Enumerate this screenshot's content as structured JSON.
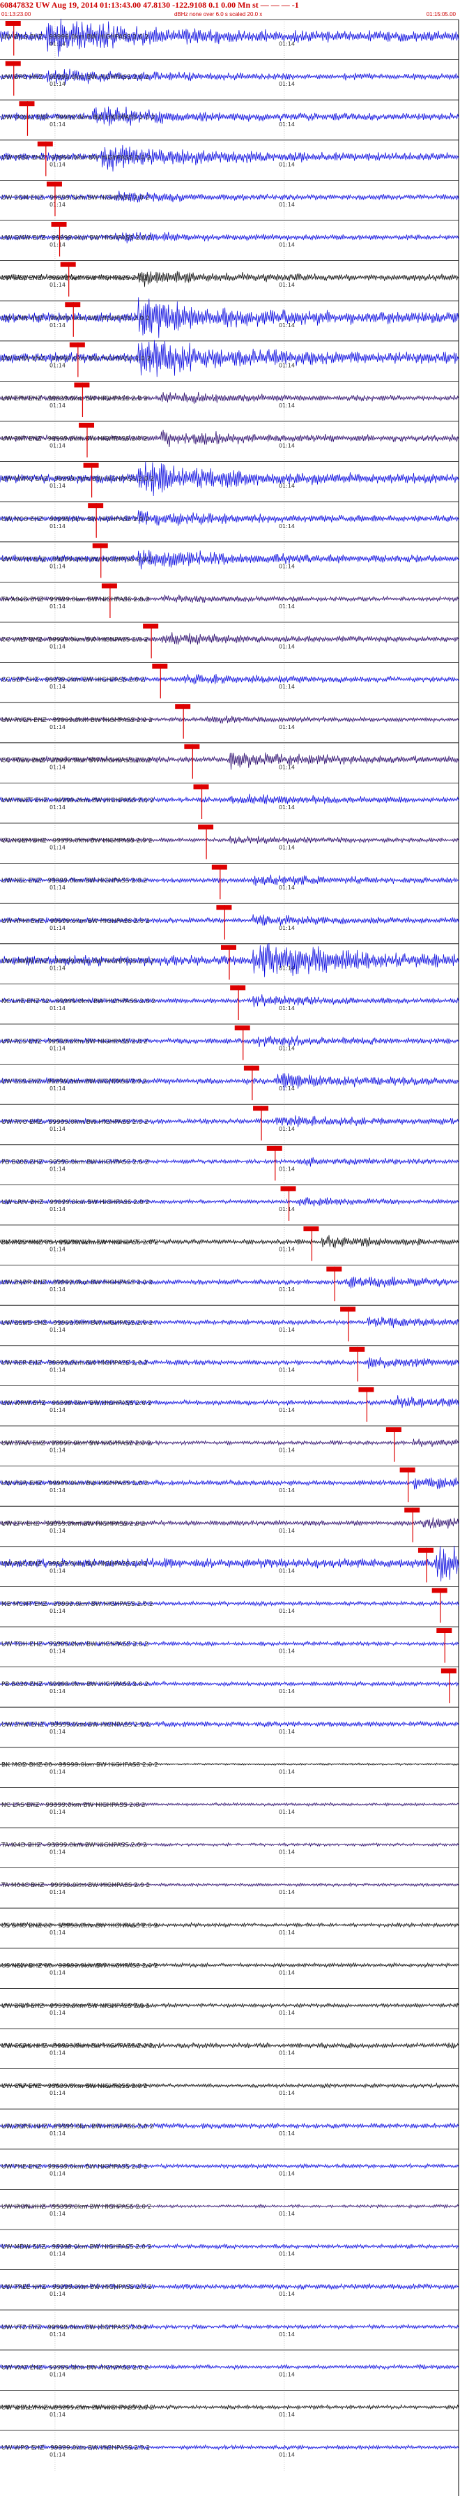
{
  "header": {
    "title": "60847832 UW Aug 19, 2014 01:13:43.00   47.8130  -122.9108  0.1 0.00 Mn st — — — -1",
    "left_time": "01:13:23.00",
    "right_time": "01:15:05.00",
    "scale_note": "dBHz none over 6.0 s scaled 20.0 x"
  },
  "colors": {
    "trace_blue": "#0000dd",
    "trace_dark": "#220066",
    "trace_black": "#000000",
    "pick_red": "#dd0000",
    "frame": "#000000"
  },
  "chart_data": {
    "type": "line",
    "tick_label": "01:14",
    "filter_suffix": "- 99999.0km BW HIGHPASS 2.0 2",
    "traces": [
      {
        "station": "UW BILS EHZ",
        "amp": 1.0,
        "color": "blue",
        "pick": 0.03,
        "burst": 0.1
      },
      {
        "station": "UW BPO HHZ",
        "amp": 0.6,
        "color": "blue",
        "pick": 0.03,
        "burst": 0.1
      },
      {
        "station": "UW OOW2 ENZ",
        "amp": 0.7,
        "color": "blue",
        "pick": 0.06,
        "burst": 0.2
      },
      {
        "station": "UW FRSP EHZ",
        "amp": 0.8,
        "color": "blue",
        "pick": 0.1,
        "burst": 0.22
      },
      {
        "station": "UW SQM EHZ",
        "amp": 0.5,
        "color": "blue",
        "pick": 0.12,
        "burst": 0.25
      },
      {
        "station": "UW GMW EHZ",
        "amp": 0.5,
        "color": "blue",
        "pick": 0.13,
        "burst": 0.25
      },
      {
        "station": "UW OBL EHZ",
        "amp": 0.6,
        "color": "black",
        "pick": 0.15,
        "burst": 0.3
      },
      {
        "station": "UW KMR HHZ",
        "amp": 1.0,
        "color": "blue",
        "pick": 0.16,
        "burst": 0.3
      },
      {
        "station": "UW GHW EHZ",
        "amp": 1.0,
        "color": "blue",
        "pick": 0.17,
        "burst": 0.3
      },
      {
        "station": "UW EPH EHZ",
        "amp": 0.5,
        "color": "dark",
        "pick": 0.18,
        "burst": 0.35
      },
      {
        "station": "UW PNT EHZ",
        "amp": 0.6,
        "color": "dark",
        "pick": 0.19,
        "burst": 0.35
      },
      {
        "station": "UW MVRO EHZ",
        "amp": 0.9,
        "color": "blue",
        "pick": 0.2,
        "burst": 0.3
      },
      {
        "station": "UW NCO EHZ",
        "amp": 0.6,
        "color": "blue",
        "pick": 0.21,
        "burst": 0.3
      },
      {
        "station": "UW OPYH EHZ",
        "amp": 0.7,
        "color": "blue",
        "pick": 0.22,
        "burst": 0.3
      },
      {
        "station": "TA A04D BHZ",
        "amp": 0.4,
        "color": "dark",
        "pick": 0.24,
        "burst": 0.35
      },
      {
        "station": "CC VALT BHZ",
        "amp": 0.5,
        "color": "dark",
        "pick": 0.33,
        "burst": 0.35
      },
      {
        "station": "CC SEP EHZ",
        "amp": 0.5,
        "color": "blue",
        "pick": 0.35,
        "burst": 0.4
      },
      {
        "station": "UW RVCH EHZ",
        "amp": 0.4,
        "color": "dark",
        "pick": 0.4,
        "burst": 0.45
      },
      {
        "station": "CC TGBU BHZ",
        "amp": 0.6,
        "color": "dark",
        "pick": 0.42,
        "burst": 0.5
      },
      {
        "station": "UW HWET EHZ",
        "amp": 0.5,
        "color": "blue",
        "pick": 0.44,
        "burst": 0.5
      },
      {
        "station": "CC NGEM BHZ",
        "amp": 0.4,
        "color": "dark",
        "pick": 0.45,
        "burst": 0.5
      },
      {
        "station": "UW NEL EHZ",
        "amp": 0.5,
        "color": "blue",
        "pick": 0.48,
        "burst": 0.55
      },
      {
        "station": "UW RPHI EHZ",
        "amp": 0.5,
        "color": "blue",
        "pick": 0.49,
        "burst": 0.55
      },
      {
        "station": "UW LNWN EHZ",
        "amp": 1.0,
        "color": "blue",
        "pick": 0.5,
        "burst": 0.55
      },
      {
        "station": "NC LHE EHZ 02",
        "amp": 0.5,
        "color": "blue",
        "pick": 0.52,
        "burst": 0.55
      },
      {
        "station": "UW RCS EHZ",
        "amp": 0.5,
        "color": "blue",
        "pick": 0.53,
        "burst": 0.55
      },
      {
        "station": "UW SSS EHZ",
        "amp": 0.6,
        "color": "blue",
        "pick": 0.55,
        "burst": 0.6
      },
      {
        "station": "UW RVO EHZ",
        "amp": 0.5,
        "color": "blue",
        "pick": 0.57,
        "burst": 0.6
      },
      {
        "station": "PB B005 EHZ",
        "amp": 0.4,
        "color": "blue",
        "pick": 0.6,
        "burst": 0.65
      },
      {
        "station": "UW LRIV BHZ",
        "amp": 0.4,
        "color": "blue",
        "pick": 0.63,
        "burst": 0.65
      },
      {
        "station": "BK MOD HHZ 00",
        "amp": 0.5,
        "color": "black",
        "pick": 0.68,
        "burst": 0.7
      },
      {
        "station": "UW BABR BHZ",
        "amp": 0.5,
        "color": "blue",
        "pick": 0.73,
        "burst": 0.75
      },
      {
        "station": "UW BEND EHZ",
        "amp": 0.5,
        "color": "blue",
        "pick": 0.76,
        "burst": 0.8
      },
      {
        "station": "UW RER EHZ",
        "amp": 0.5,
        "color": "blue",
        "pick": 0.78,
        "burst": 0.8
      },
      {
        "station": "UW WRW EHZ",
        "amp": 0.5,
        "color": "blue",
        "pick": 0.8,
        "burst": 0.85
      },
      {
        "station": "UW STAR EHZ",
        "amp": 0.4,
        "color": "dark",
        "pick": 0.86,
        "burst": 0.9
      },
      {
        "station": "UW HSR EHZ",
        "amp": 0.5,
        "color": "blue",
        "pick": 0.89,
        "burst": 0.9
      },
      {
        "station": "UW LTY EHZ",
        "amp": 0.5,
        "color": "dark",
        "pick": 0.9,
        "burst": 0.92
      },
      {
        "station": "UW RVC EHZ",
        "amp": 0.9,
        "color": "blue",
        "pick": 0.93,
        "burst": 0.95
      },
      {
        "station": "MB MCMT EHZ",
        "amp": 0.4,
        "color": "blue",
        "pick": 0.96,
        "burst": null
      },
      {
        "station": "UW TDH EHZ",
        "amp": 0.4,
        "color": "blue",
        "pick": 0.97,
        "burst": null
      },
      {
        "station": "PB B030 EHZ",
        "amp": 0.4,
        "color": "blue",
        "pick": 0.98,
        "burst": null
      },
      {
        "station": "UW SHW EHZ",
        "amp": 0.5,
        "color": "blue",
        "pick": null,
        "burst": null
      },
      {
        "station": "BK MOD BHZ 00",
        "amp": 0.2,
        "color": "black",
        "pick": null,
        "burst": null
      },
      {
        "station": "NC LAS EHZ",
        "amp": 0.3,
        "color": "dark",
        "pick": null,
        "burst": null
      },
      {
        "station": "TA I04D BHZ",
        "amp": 0.3,
        "color": "dark",
        "pick": null,
        "burst": null
      },
      {
        "station": "TA M04C BHZ",
        "amp": 0.3,
        "color": "dark",
        "pick": null,
        "burst": null
      },
      {
        "station": "US BMO BHZ 00",
        "amp": 0.4,
        "color": "black",
        "pick": null,
        "burst": null
      },
      {
        "station": "US NEW BHZ 00",
        "amp": 0.4,
        "color": "black",
        "pick": null,
        "burst": null
      },
      {
        "station": "UW BRW EHZ",
        "amp": 0.4,
        "color": "black",
        "pick": null,
        "burst": null
      },
      {
        "station": "UW CCRK HHZ",
        "amp": 0.5,
        "color": "black",
        "pick": null,
        "burst": null
      },
      {
        "station": "UW CRF EHZ",
        "amp": 0.4,
        "color": "black",
        "pick": null,
        "burst": null
      },
      {
        "station": "UW DDRF HHZ",
        "amp": 0.5,
        "color": "blue",
        "pick": null,
        "burst": null
      },
      {
        "station": "UW FHE EHZ",
        "amp": 0.4,
        "color": "blue",
        "pick": null,
        "burst": null
      },
      {
        "station": "UW IRON HHZ",
        "amp": 0.3,
        "color": "dark",
        "pick": null,
        "burst": null
      },
      {
        "station": "UW MDW EHZ",
        "amp": 0.4,
        "color": "blue",
        "pick": null,
        "burst": null
      },
      {
        "station": "UW TREE HHZ",
        "amp": 0.5,
        "color": "blue",
        "pick": null,
        "burst": null
      },
      {
        "station": "UW VT2 EHZ",
        "amp": 0.4,
        "color": "blue",
        "pick": null,
        "burst": null
      },
      {
        "station": "UW WAT EHZ",
        "amp": 0.4,
        "color": "blue",
        "pick": null,
        "burst": null
      },
      {
        "station": "UW WDLL HHZ",
        "amp": 0.4,
        "color": "black",
        "pick": null,
        "burst": null
      },
      {
        "station": "UW WPO EHZ",
        "amp": 0.4,
        "color": "blue",
        "pick": null,
        "burst": null
      }
    ]
  }
}
